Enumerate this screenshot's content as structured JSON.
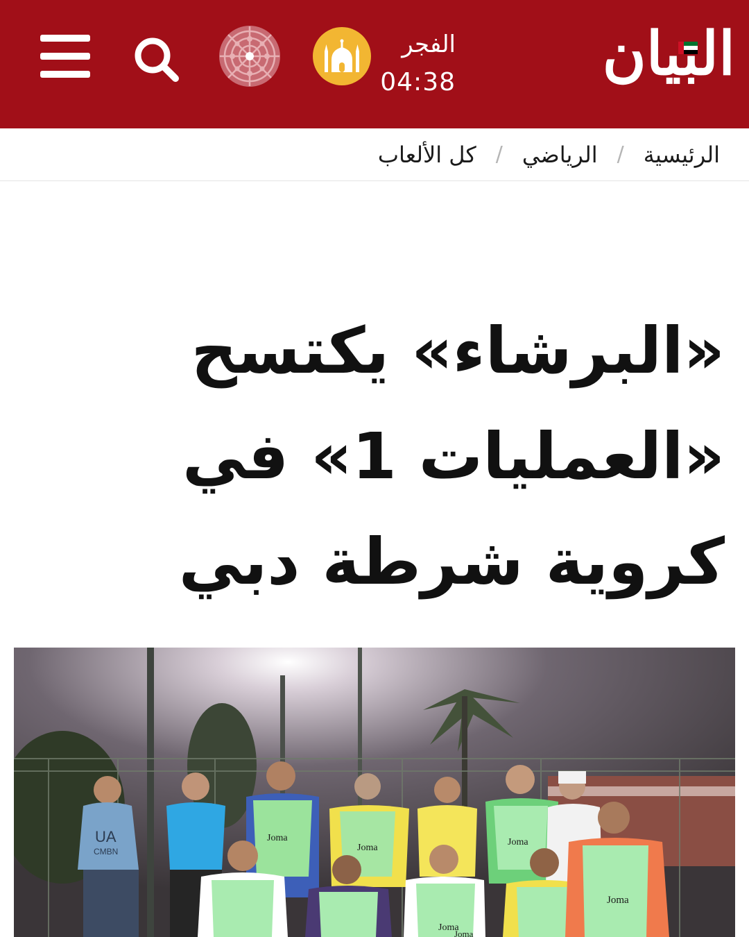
{
  "header": {
    "logo_text": "البيان",
    "prayer": {
      "name": "الفجر",
      "time": "04:38"
    },
    "menu_icon": "hamburger-menu-icon",
    "search_icon": "search-icon",
    "emblem_icon": "geometric-emblem-icon",
    "mosque_icon": "mosque-icon",
    "colors": {
      "brand": "#a10f18",
      "prayer_badge": "#f2b632"
    }
  },
  "breadcrumb": {
    "items": [
      "الرئيسية",
      "الرياضي",
      "كل الألعاب"
    ],
    "separator": "/"
  },
  "article": {
    "headline": "«البرشاء» يكتسح «العمليات 1» في كروية شرطة دبي"
  },
  "photo": {
    "shirt_texts": [
      "UA",
      "CMBN",
      "Joma",
      "Joma",
      "Joma",
      "Joma",
      "Joma",
      "Joma"
    ]
  }
}
